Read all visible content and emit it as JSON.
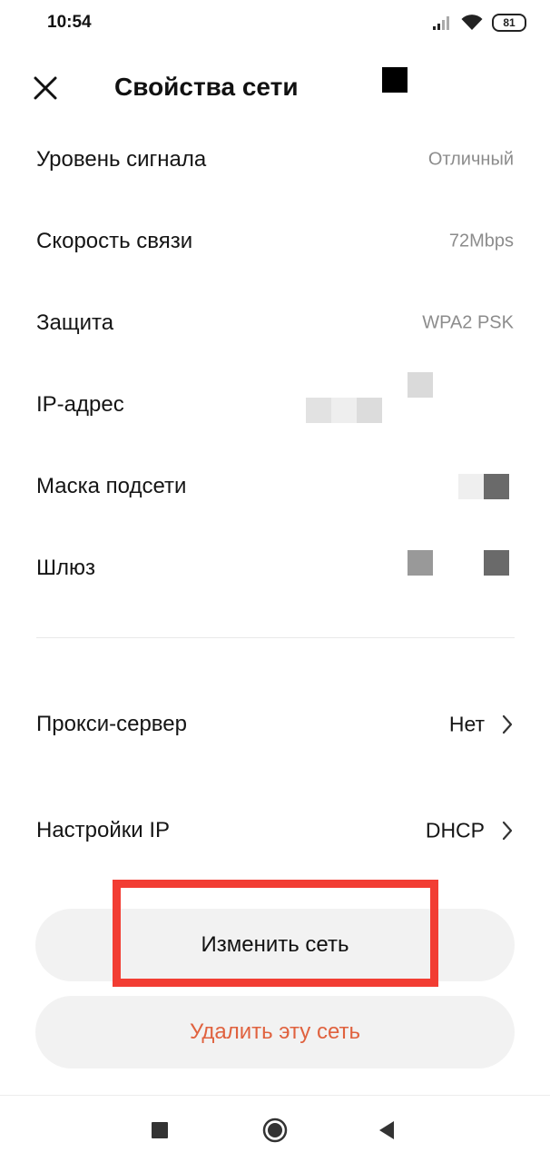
{
  "status_bar": {
    "time": "10:54",
    "battery": "81",
    "icons": [
      "signal-icon",
      "wifi-icon",
      "battery-icon"
    ]
  },
  "header": {
    "title": "Свойства сети",
    "close_icon": "close-icon"
  },
  "info_rows": [
    {
      "label": "Уровень сигнала",
      "value": "Отличный"
    },
    {
      "label": "Скорость связи",
      "value": "72Mbps"
    },
    {
      "label": "Защита",
      "value": "WPA2 PSK"
    },
    {
      "label": "IP-адрес",
      "value": ""
    },
    {
      "label": "Маска подсети",
      "value": ""
    },
    {
      "label": "Шлюз",
      "value": ""
    }
  ],
  "nav_rows": [
    {
      "label": "Прокси-сервер",
      "value": "Нет",
      "icon": "chevron-right-icon"
    },
    {
      "label": "Настройки IP",
      "value": "DHCP",
      "icon": "chevron-right-icon"
    }
  ],
  "buttons": {
    "edit": "Изменить сеть",
    "delete": "Удалить эту сеть"
  },
  "colors": {
    "accent_delete": "#e0623f",
    "highlight": "#f23d33",
    "button_bg": "#f2f2f2"
  },
  "system_nav": {
    "icons": [
      "recents-icon",
      "home-icon",
      "back-icon"
    ]
  }
}
